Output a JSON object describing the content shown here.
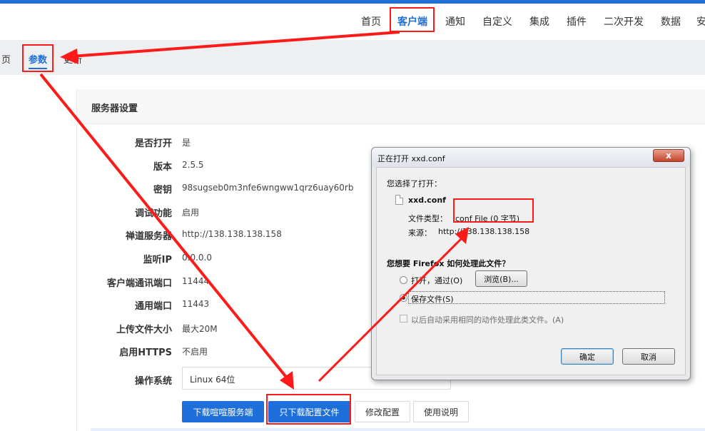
{
  "nav": {
    "items": [
      {
        "label": "首页",
        "active": false
      },
      {
        "label": "客户端",
        "active": true
      },
      {
        "label": "通知",
        "active": false
      },
      {
        "label": "自定义",
        "active": false
      },
      {
        "label": "集成",
        "active": false
      },
      {
        "label": "插件",
        "active": false
      },
      {
        "label": "二次开发",
        "active": false
      },
      {
        "label": "数据",
        "active": false
      },
      {
        "label": "安",
        "active": false
      }
    ]
  },
  "subtabs": {
    "items": [
      {
        "label": "页",
        "active": false
      },
      {
        "label": "参数",
        "active": true
      },
      {
        "label": "更新",
        "active": false
      }
    ]
  },
  "server_settings": {
    "title": "服务器设置",
    "rows": [
      {
        "label": "是否打开",
        "value": "是"
      },
      {
        "label": "版本",
        "value": "2.5.5"
      },
      {
        "label": "密钥",
        "value": "98sugseb0m3nfe6wngww1qrz6uay60rb"
      },
      {
        "label": "调试功能",
        "value": "启用"
      },
      {
        "label": "禅道服务器",
        "value": "http://138.138.138.158"
      },
      {
        "label": "监听IP",
        "value": "0.0.0.0"
      },
      {
        "label": "客户端通讯端口",
        "value": "11444"
      },
      {
        "label": "通用端口",
        "value": "11443"
      },
      {
        "label": "上传文件大小",
        "value": "最大20M"
      },
      {
        "label": "启用HTTPS",
        "value": "不启用"
      }
    ],
    "os_label": "操作系统",
    "os_value": "Linux 64位",
    "buttons": {
      "download_server": "下载喧喧服务端",
      "download_config": "只下载配置文件",
      "edit_config": "修改配置",
      "usage": "使用说明"
    }
  },
  "dialog": {
    "title": "正在打开 xxd.conf",
    "close": "x",
    "chosen_to_open": "您选择了打开：",
    "filename": "xxd.conf",
    "filetype_label": "文件类型：",
    "filetype_value": "conf File (0 字节)",
    "source_label": "来源：",
    "source_value": "http://138.138.138.158",
    "question": "您想要 Firefox 如何处理此文件？",
    "open_with_label": "打开，通过(O)",
    "browse_button": "浏览(B)...",
    "save_file_label": "保存文件(S)",
    "auto_label": "以后自动采用相同的动作处理此类文件。(A)",
    "ok": "确定",
    "cancel": "取消"
  },
  "colors": {
    "accent": "#1e6fd9",
    "annotation": "#ff1a1a"
  }
}
